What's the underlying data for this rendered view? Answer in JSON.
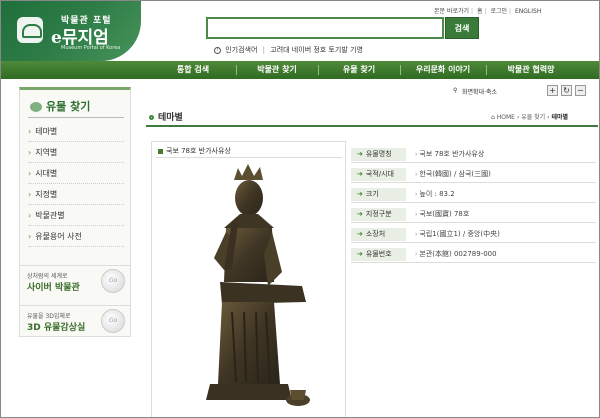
{
  "header": {
    "logo_top": "박물관 포털",
    "logo_main": "e뮤지엄",
    "logo_sub": "Museum Portal of Korea",
    "search_button": "검색",
    "search_placeholder": "",
    "popular_label": "인기검색어",
    "popular_items": [
      "고려대 네이버 정호 토기발 기영"
    ],
    "utility": [
      "본문 바로가기",
      "홈",
      "로그인",
      "ENGLISH"
    ]
  },
  "nav": {
    "items": [
      "통합 검색",
      "박물관 찾기",
      "유물 찾기",
      "우리문화 이야기",
      "박물관 협력망"
    ]
  },
  "sidebar": {
    "title": "유물 찾기",
    "items": [
      "테마별",
      "지역별",
      "시대별",
      "지정별",
      "박물관별",
      "유물용어 사전"
    ],
    "promos": [
      {
        "small": "상처럼의 세계로",
        "large": "사이버 박물관",
        "go": "Go"
      },
      {
        "small": "유물을 3D입체로",
        "large": "3D 유물감상실",
        "go": "Go"
      }
    ]
  },
  "toolbar": {
    "zoom_label": "화면확대·축소",
    "plus": "+",
    "reset": "↻",
    "minus": "−"
  },
  "page": {
    "title": "테마별",
    "breadcrumb": [
      "HOME",
      "유물 찾기",
      "테마별"
    ]
  },
  "artifact": {
    "caption": "국보 78호 반가사유상",
    "rows": [
      {
        "label": "유물명칭",
        "value": "국보 78호 반가사유상"
      },
      {
        "label": "국적/시대",
        "value": "한국(韓國) / 삼국(三國)"
      },
      {
        "label": "크기",
        "value": "높이 : 83.2"
      },
      {
        "label": "지정구분",
        "value": "국보(國寶) 78호"
      },
      {
        "label": "소장처",
        "value": "국립1(國立1) / 중앙(中央)"
      },
      {
        "label": "유물번호",
        "value": "본관(本館) 002789-000"
      }
    ]
  },
  "colors": {
    "brand_green": "#2e7d47",
    "nav_green": "#3a7a2a",
    "accent_light": "#e9efe4"
  }
}
